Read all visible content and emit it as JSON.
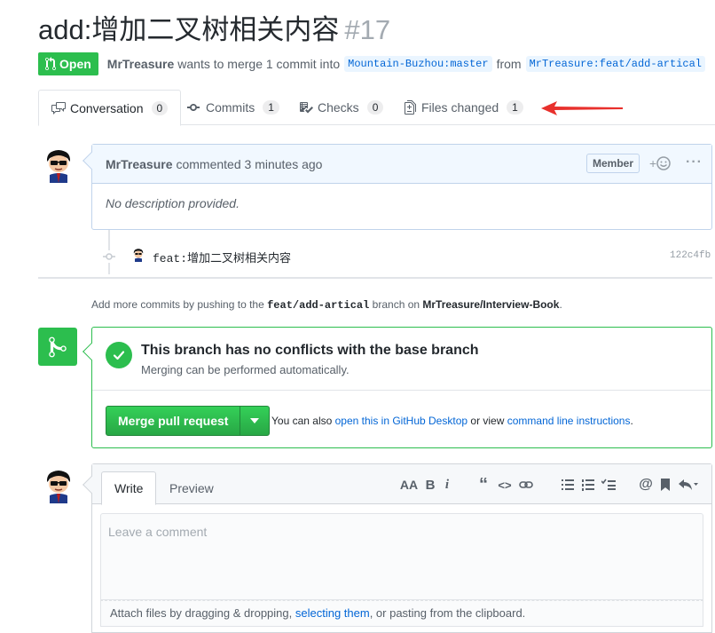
{
  "pr": {
    "title": "add:增加二叉树相关内容",
    "number": "#17",
    "state": "Open",
    "author": "MrTreasure",
    "merge_text": "wants to merge 1 commit into",
    "base_branch": "Mountain-Buzhou:master",
    "from_text": "from",
    "head_branch": "MrTreasure:feat/add-artical"
  },
  "tabs": [
    {
      "label": "Conversation",
      "count": "0"
    },
    {
      "label": "Commits",
      "count": "1"
    },
    {
      "label": "Checks",
      "count": "0"
    },
    {
      "label": "Files changed",
      "count": "1"
    }
  ],
  "comment": {
    "author": "MrTreasure",
    "action": "commented 3 minutes ago",
    "role": "Member",
    "body": "No description provided."
  },
  "commit": {
    "message": "feat:增加二叉树相关内容",
    "sha": "122c4fb"
  },
  "hint": {
    "prefix": "Add more commits by pushing to the",
    "branch": "feat/add-artical",
    "middle": "branch on",
    "repo": "MrTreasure/Interview-Book",
    "suffix": "."
  },
  "merge": {
    "title": "This branch has no conflicts with the base branch",
    "subtitle": "Merging can be performed automatically.",
    "button": "Merge pull request",
    "also_prefix": "You can also",
    "desktop_link": "open this in GitHub Desktop",
    "or_view": "or view",
    "cli_link": "command line instructions",
    "period": "."
  },
  "editor": {
    "write_tab": "Write",
    "preview_tab": "Preview",
    "placeholder": "Leave a comment",
    "attach_prefix": "Attach files by dragging & dropping,",
    "attach_link": "selecting them",
    "attach_suffix": ", or pasting from the clipboard.",
    "toolbar": [
      "header-icon",
      "bold-icon",
      "italic-icon",
      "quote-icon",
      "code-icon",
      "link-icon",
      "unordered-list-icon",
      "ordered-list-icon",
      "tasklist-icon",
      "mention-icon",
      "bookmark-icon",
      "reply-icon"
    ]
  },
  "colors": {
    "open_green": "#2cbe4e",
    "link_blue": "#0366d6",
    "annotation_red": "#e8302c"
  }
}
